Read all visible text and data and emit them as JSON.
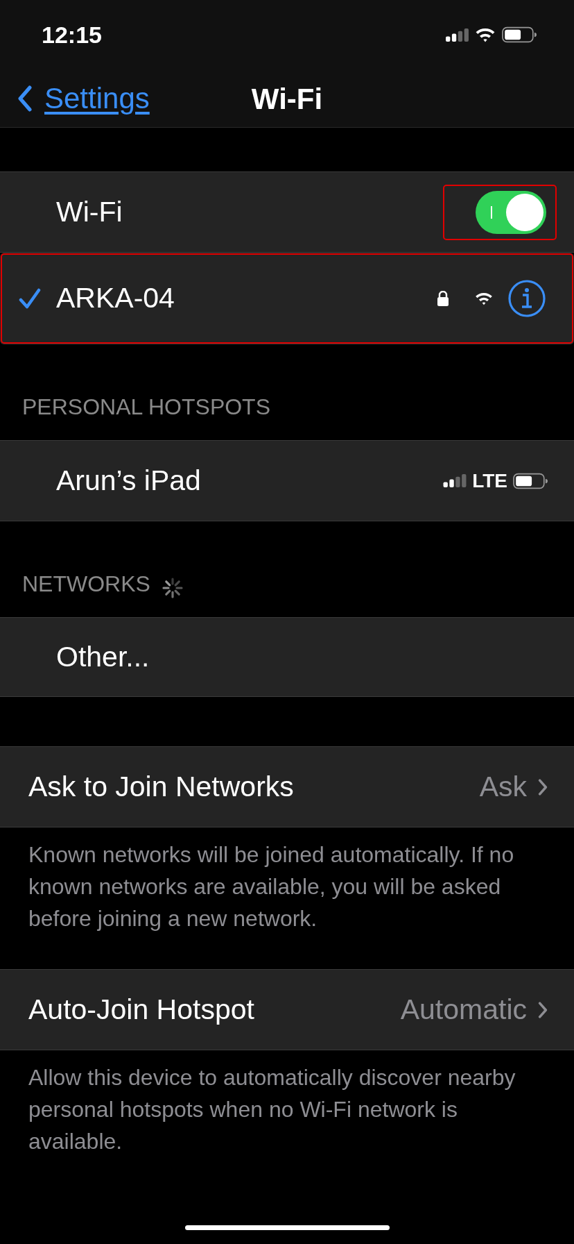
{
  "status_bar": {
    "time": "12:15"
  },
  "nav": {
    "back_label": "Settings",
    "title": "Wi-Fi"
  },
  "wifi": {
    "label": "Wi-Fi",
    "on": true,
    "highlighted": true
  },
  "connected": {
    "name": "ARKA-04",
    "selected": true,
    "locked": true,
    "highlighted": true
  },
  "sections": [
    {
      "header": "PERSONAL HOTSPOTS",
      "loading": false,
      "rows": [
        {
          "kind": "hotspot",
          "label": "Arun’s iPad",
          "network": "LTE"
        }
      ]
    },
    {
      "header": "NETWORKS",
      "loading": true,
      "rows": [
        {
          "kind": "plain",
          "label": "Other..."
        }
      ]
    }
  ],
  "settings": [
    {
      "label": "Ask to Join Networks",
      "value": "Ask",
      "footer": "Known networks will be joined automatically. If no known networks are available, you will be asked before joining a new network."
    },
    {
      "label": "Auto-Join Hotspot",
      "value": "Automatic",
      "footer": "Allow this device to automatically discover nearby personal hotspots when no Wi-Fi network is available."
    }
  ]
}
